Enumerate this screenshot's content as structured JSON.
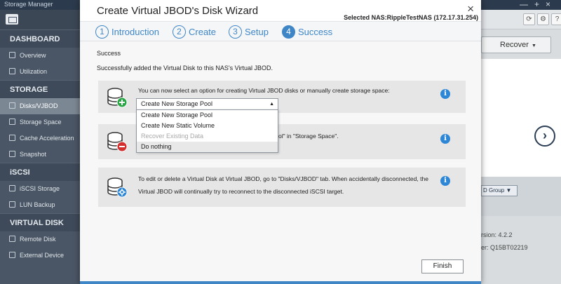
{
  "app": {
    "title": "Storage Manager",
    "window_controls": [
      "—",
      "+",
      "×"
    ]
  },
  "sidebar": {
    "sections": [
      {
        "label": "DASHBOARD",
        "items": [
          {
            "label": "Overview"
          },
          {
            "label": "Utilization"
          }
        ]
      },
      {
        "label": "STORAGE",
        "items": [
          {
            "label": "Disks/VJBOD",
            "active": true
          },
          {
            "label": "Storage Space"
          },
          {
            "label": "Cache Acceleration"
          },
          {
            "label": "Snapshot"
          }
        ]
      },
      {
        "label": "iSCSI",
        "items": [
          {
            "label": "iSCSI Storage"
          },
          {
            "label": "LUN Backup"
          }
        ]
      },
      {
        "label": "VIRTUAL DISK",
        "items": [
          {
            "label": "Remote Disk"
          },
          {
            "label": "External Device"
          }
        ]
      }
    ]
  },
  "background_right": {
    "recover_label": "Recover",
    "jbod_group_label": "D Group",
    "version_text": "rsion: 4.2.2",
    "serial_text": "er: Q15BT02219"
  },
  "wizard": {
    "title": "Create Virtual JBOD's Disk Wizard",
    "close_label": "×",
    "nas_label": "Selected NAS:RippleTestNAS (172.17.31.254)",
    "steps": [
      {
        "number": "1",
        "label": "Introduction"
      },
      {
        "number": "2",
        "label": "Create"
      },
      {
        "number": "3",
        "label": "Setup"
      },
      {
        "number": "4",
        "label": "Success",
        "active": true
      }
    ],
    "heading": "Success",
    "subtext": "Successfully added the Virtual Disk to this NAS's Virtual JBOD.",
    "card1_text": "You can now select an option for creating Virtual JBOD disks or manually create storage space:",
    "card2_text": "ol\" in \"Storage Space\".",
    "card3_line1": "To edit or delete a Virtual Disk at Virtual JBOD, go to \"Disks/VJBOD\" tab. When accidentally disconnected, the",
    "card3_line2": "Virtual JBOD will continually try to reconnect to the disconnected iSCSI target.",
    "select": {
      "value": "Create New Storage Pool",
      "options": [
        {
          "label": "Create New Storage Pool"
        },
        {
          "label": "Create New Static Volume"
        },
        {
          "label": "Recover Existing Data",
          "disabled": true
        },
        {
          "label": "Do nothing",
          "hover": true
        }
      ]
    },
    "info_icon_glyph": "i",
    "finish_label": "Finish"
  },
  "colors": {
    "accent": "#3f86c7",
    "sidebar_bg": "#4a5665",
    "sidebar_active": "#7c8794",
    "info_blue": "#2d86d6",
    "add_green": "#28a745",
    "remove_red": "#d32f2f",
    "gear_blue": "#2d86d6"
  }
}
